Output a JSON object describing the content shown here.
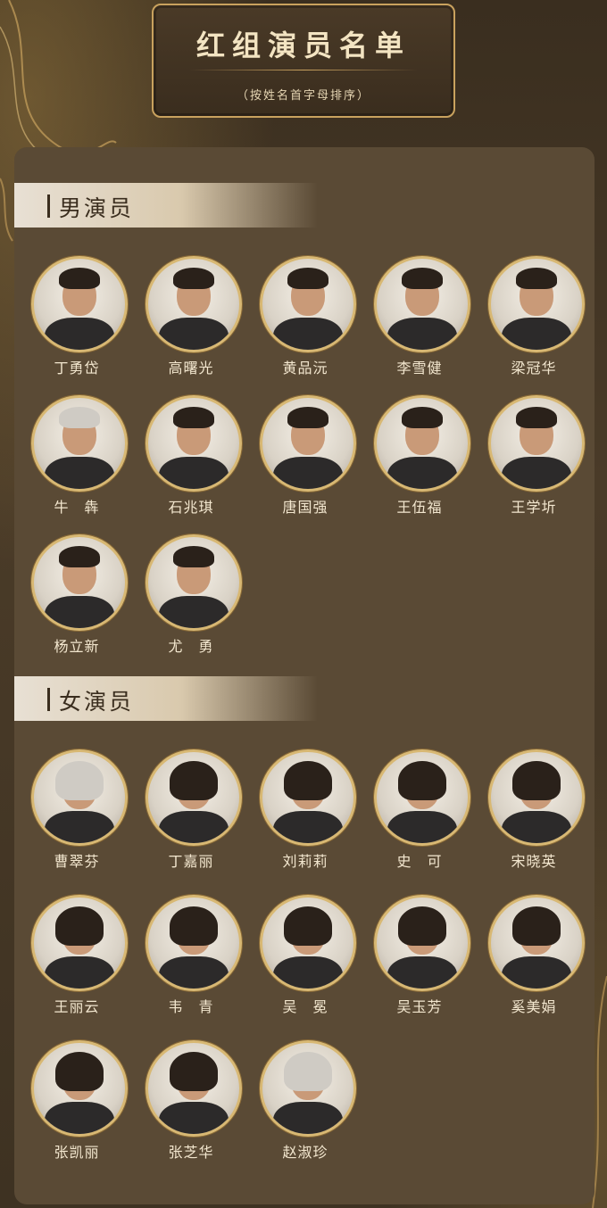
{
  "header": {
    "title": "红组演员名单",
    "subtitle": "（按姓名首字母排序）"
  },
  "sections": {
    "male": {
      "label": "男演员",
      "actors": [
        "丁勇岱",
        "高曙光",
        "黄品沅",
        "李雪健",
        "梁冠华",
        "牛　犇",
        "石兆琪",
        "唐国强",
        "王伍福",
        "王学圻",
        "杨立新",
        "尤　勇"
      ]
    },
    "female": {
      "label": "女演员",
      "actors": [
        "曹翠芬",
        "丁嘉丽",
        "刘莉莉",
        "史　可",
        "宋晓英",
        "王丽云",
        "韦　青",
        "吴　冕",
        "吴玉芳",
        "奚美娟",
        "张凯丽",
        "张芝华",
        "赵淑珍"
      ]
    }
  },
  "colors": {
    "accent_gold": "#c9a25e",
    "panel": "#5a4a35",
    "background": "#3d3020",
    "text_light": "#f3e7cf"
  }
}
